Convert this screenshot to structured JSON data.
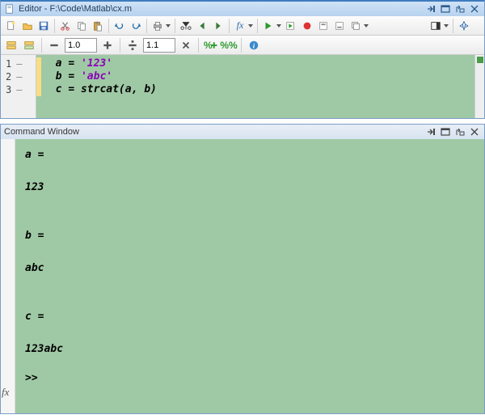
{
  "editor": {
    "title": "Editor - F:\\Code\\Matlab\\cx.m",
    "toolbar2": {
      "scale": "1.0",
      "divide": "1.1"
    },
    "lines": [
      {
        "num": "1",
        "var": "a",
        "eq": "=",
        "rhs": "'123'",
        "rhs_is_str": true
      },
      {
        "num": "2",
        "var": "b",
        "eq": "=",
        "rhs": "'abc'",
        "rhs_is_str": true
      },
      {
        "num": "3",
        "var": "c",
        "eq": "=",
        "rhs": "strcat(a, b)",
        "rhs_is_str": false
      }
    ]
  },
  "command": {
    "title": "Command Window",
    "output": [
      "a =",
      "",
      "123",
      "",
      "",
      "b =",
      "",
      "abc",
      "",
      "",
      "c =",
      "",
      "123abc"
    ],
    "prompt": ">>",
    "fx": "fx"
  }
}
